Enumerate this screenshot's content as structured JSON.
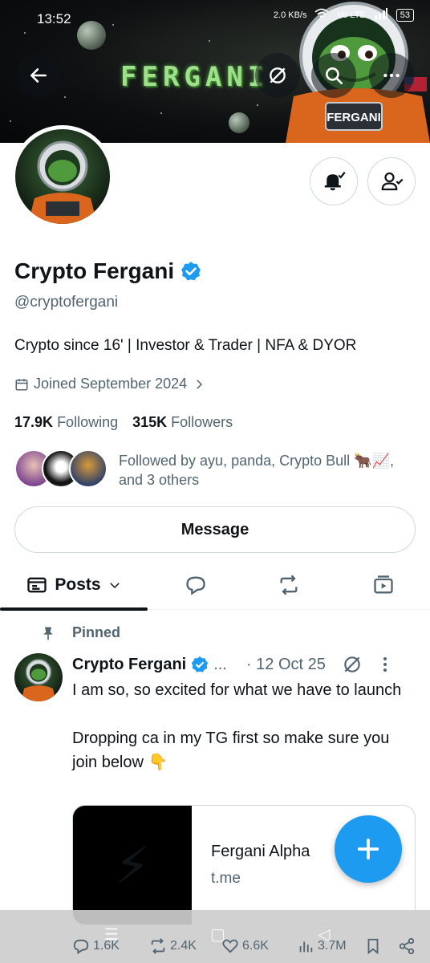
{
  "status_bar": {
    "time": "13:52",
    "network": "2.0 KB/s",
    "signal": "Vo LTE",
    "battery": "53"
  },
  "header": {
    "banner_text": "FERGANI",
    "back_label": "back",
    "grok_label": "grok",
    "search_label": "search",
    "more_label": "more"
  },
  "profile": {
    "name": "Crypto Fergani",
    "handle": "@cryptofergani",
    "bio": "Crypto since 16' | Investor & Trader | NFA & DYOR",
    "joined": "Joined September 2024",
    "following_count": "17.9K",
    "following_label": "Following",
    "followers_count": "315K",
    "followers_label": "Followers",
    "followed_by": "Followed by ayu, panda, Crypto Bull 🐂📈, and 3 others",
    "message_label": "Message"
  },
  "tabs": {
    "posts_label": "Posts"
  },
  "post": {
    "pinned_label": "Pinned",
    "author": "Crypto Fergani",
    "ellipsis": "...",
    "date": "· 12 Oct 25",
    "text": "I am so, so excited for what we have to launch\n\nDropping ca in my TG first so make sure you join below 👇",
    "card_title": "Fergani Alpha",
    "card_domain": "t.me",
    "card_emoji": "⚡",
    "replies": "1.6K",
    "reposts": "2.4K",
    "likes": "6.6K",
    "views": "3.7M"
  },
  "colors": {
    "accent": "#1d9bf0",
    "text": "#0f1419",
    "muted": "#536471",
    "border": "#cfd9de"
  }
}
